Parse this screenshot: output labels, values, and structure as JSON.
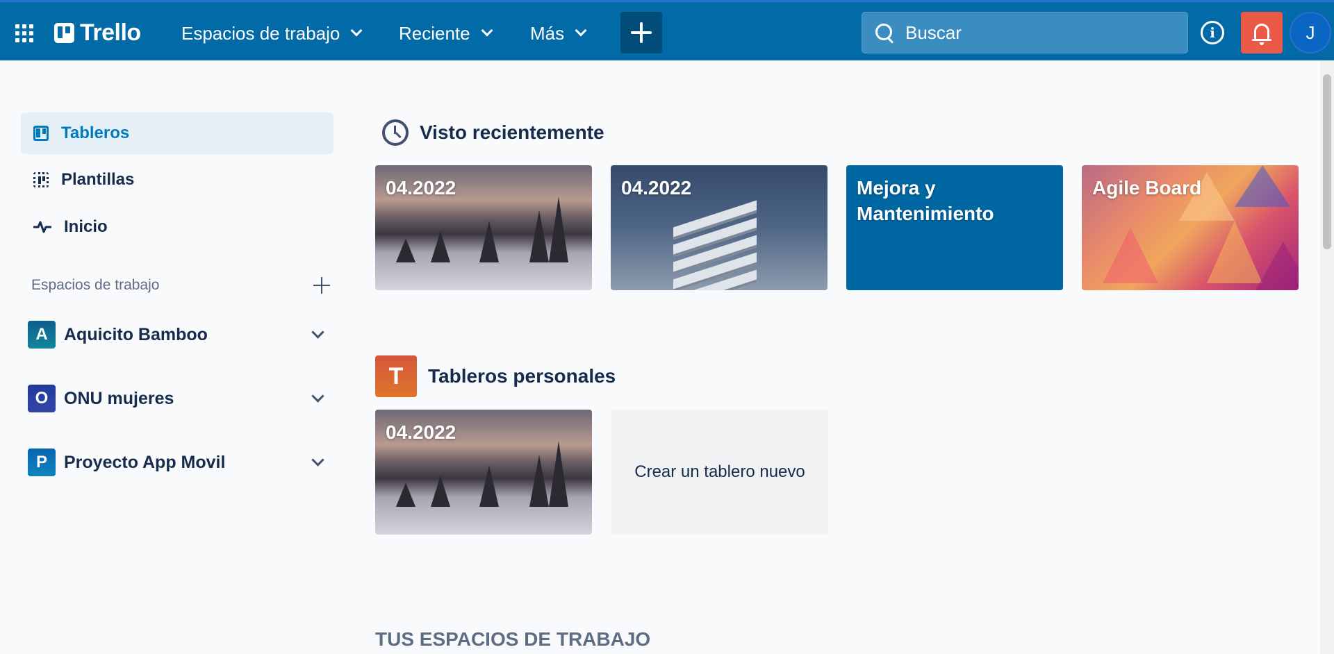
{
  "header": {
    "app_name": "Trello",
    "menus": [
      {
        "label": "Espacios de trabajo"
      },
      {
        "label": "Reciente"
      },
      {
        "label": "Más"
      }
    ],
    "search_placeholder": "Buscar",
    "avatar_initial": "J",
    "info_symbol": "i",
    "colors": {
      "bar": "#026aa7",
      "notification": "#eb5a46",
      "create": "#014c78"
    }
  },
  "sidebar": {
    "nav": [
      {
        "label": "Tableros",
        "icon": "boards-icon",
        "active": true
      },
      {
        "label": "Plantillas",
        "icon": "templates-icon",
        "active": false
      },
      {
        "label": "Inicio",
        "icon": "activity-icon",
        "active": false
      }
    ],
    "workspaces_label": "Espacios de trabajo",
    "workspaces": [
      {
        "initial": "A",
        "name": "Aquicito Bamboo",
        "color": "#0b6e8c"
      },
      {
        "initial": "O",
        "name": "ONU mujeres",
        "color": "#2a3d9c"
      },
      {
        "initial": "P",
        "name": "Proyecto App Movil",
        "color": "#0a72b5"
      }
    ]
  },
  "main": {
    "recent": {
      "title": "Visto recientemente",
      "boards": [
        {
          "title": "04.2022",
          "background": "snow-landscape"
        },
        {
          "title": "04.2022",
          "background": "modern-building"
        },
        {
          "title": "Mejora y Mantenimiento",
          "background": "#0067a3"
        },
        {
          "title": "Agile Board",
          "background": "polygon-gradient"
        }
      ]
    },
    "personal": {
      "badge": "T",
      "title": "Tableros personales",
      "boards": [
        {
          "title": "04.2022",
          "background": "snow-landscape"
        }
      ],
      "create_label": "Crear un tablero nuevo"
    },
    "workspaces_heading": "TUS ESPACIOS DE TRABAJO"
  }
}
